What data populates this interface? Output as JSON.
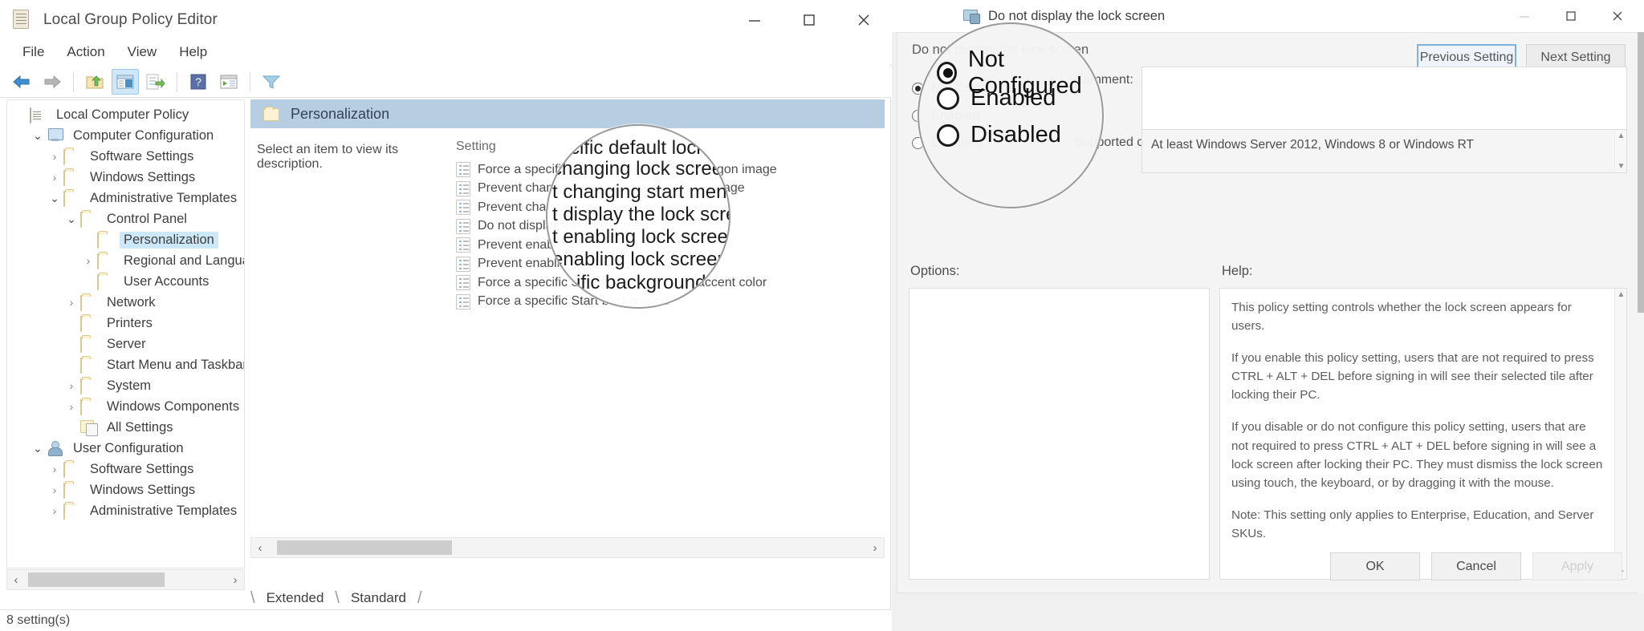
{
  "gpedit": {
    "title": "Local Group Policy Editor",
    "title_icon": "policy-document-icon",
    "window_controls": {
      "minimize": "minimize-icon",
      "maximize": "maximize-icon",
      "close": "close-icon"
    },
    "menu": [
      "File",
      "Action",
      "View",
      "Help"
    ],
    "toolbar_icons": [
      "back-arrow-icon",
      "forward-arrow-icon",
      "up-folder-icon",
      "show-hide-console-tree-icon",
      "export-list-icon",
      "help-icon",
      "show-hide-action-pane-icon",
      "filter-icon"
    ],
    "tree": [
      {
        "label": "Local Computer Policy",
        "indent": 0,
        "chevron": "",
        "icon": "policy-document-icon",
        "selected": false
      },
      {
        "label": "Computer Configuration",
        "indent": 1,
        "chevron": "open",
        "icon": "computer-icon",
        "selected": false
      },
      {
        "label": "Software Settings",
        "indent": 2,
        "chevron": "closed",
        "icon": "folder-icon",
        "selected": false
      },
      {
        "label": "Windows Settings",
        "indent": 2,
        "chevron": "closed",
        "icon": "folder-icon",
        "selected": false
      },
      {
        "label": "Administrative Templates",
        "indent": 2,
        "chevron": "open",
        "icon": "folder-icon",
        "selected": false
      },
      {
        "label": "Control Panel",
        "indent": 3,
        "chevron": "open",
        "icon": "folder-icon",
        "selected": false
      },
      {
        "label": "Personalization",
        "indent": 4,
        "chevron": "",
        "icon": "folder-icon",
        "selected": true
      },
      {
        "label": "Regional and Language Options",
        "indent": 4,
        "chevron": "closed",
        "icon": "folder-icon",
        "selected": false
      },
      {
        "label": "User Accounts",
        "indent": 4,
        "chevron": "",
        "icon": "folder-icon",
        "selected": false
      },
      {
        "label": "Network",
        "indent": 3,
        "chevron": "closed",
        "icon": "folder-icon",
        "selected": false
      },
      {
        "label": "Printers",
        "indent": 3,
        "chevron": "",
        "icon": "folder-icon",
        "selected": false
      },
      {
        "label": "Server",
        "indent": 3,
        "chevron": "",
        "icon": "folder-icon",
        "selected": false
      },
      {
        "label": "Start Menu and Taskbar",
        "indent": 3,
        "chevron": "",
        "icon": "folder-icon",
        "selected": false
      },
      {
        "label": "System",
        "indent": 3,
        "chevron": "closed",
        "icon": "folder-icon",
        "selected": false
      },
      {
        "label": "Windows Components",
        "indent": 3,
        "chevron": "closed",
        "icon": "folder-icon",
        "selected": false
      },
      {
        "label": "All Settings",
        "indent": 3,
        "chevron": "",
        "icon": "all-settings-icon",
        "selected": false
      },
      {
        "label": "User Configuration",
        "indent": 1,
        "chevron": "open",
        "icon": "user-icon",
        "selected": false
      },
      {
        "label": "Software Settings",
        "indent": 2,
        "chevron": "closed",
        "icon": "folder-icon",
        "selected": false
      },
      {
        "label": "Windows Settings",
        "indent": 2,
        "chevron": "closed",
        "icon": "folder-icon",
        "selected": false
      },
      {
        "label": "Administrative Templates",
        "indent": 2,
        "chevron": "closed",
        "icon": "folder-icon",
        "selected": false
      }
    ],
    "pane": {
      "header_title": "Personalization",
      "description_hint": "Select an item to view its description.",
      "column_header": "Setting",
      "settings": [
        "Force a specific default lock screen and logon image",
        "Prevent changing lock screen and logon image",
        "Prevent changing start menu background",
        "Do not display the lock screen",
        "Prevent enabling lock screen camera",
        "Prevent enabling lock screen slide show",
        "Force a specific Start background and accent color",
        "Force a specific Start background"
      ]
    },
    "tabs": [
      "Extended",
      "Standard"
    ],
    "active_tab": "Standard",
    "status": "8 setting(s)"
  },
  "dialog": {
    "title": "Do not display the lock screen",
    "title_icon": "policy-setting-icon",
    "window_controls": {
      "minimize": "minimize-icon",
      "maximize": "maximize-icon",
      "close": "close-icon"
    },
    "policy_heading": "Do not display the lock screen",
    "nav": {
      "previous": "Previous Setting",
      "next": "Next Setting"
    },
    "states": [
      {
        "label": "Not Configured",
        "checked": true
      },
      {
        "label": "Enabled",
        "checked": false
      },
      {
        "label": "Disabled",
        "checked": false
      }
    ],
    "comment_label": "Comment:",
    "comment_value": "",
    "supported_label": "Supported on:",
    "supported_value": "At least Windows Server 2012, Windows 8 or Windows RT",
    "options_label": "Options:",
    "help_label": "Help:",
    "help_paragraphs": [
      "This policy setting controls whether the lock screen appears for users.",
      "If you enable this policy setting, users that are not required to press CTRL + ALT + DEL before signing in will see their selected tile after locking their PC.",
      "If you disable or do not configure this policy setting, users that are not required to press CTRL + ALT + DEL before signing in will see a lock screen after locking their PC. They must dismiss the lock screen using touch, the keyboard, or by dragging it with the mouse.",
      "Note: This setting only applies to Enterprise, Education, and Server SKUs."
    ],
    "buttons": {
      "ok": "OK",
      "cancel": "Cancel",
      "apply": "Apply"
    }
  },
  "magnifier_left": {
    "name": "magnifier-lens-settings-list",
    "rows": [
      "cific default lock screen and logon image",
      "changing lock screen and logon image",
      "t changing start menu background",
      "t display the lock screen",
      "t enabling lock screen camera",
      "enabling lock screen slide show",
      "ific background"
    ]
  },
  "magnifier_right": {
    "name": "magnifier-lens-policy-states",
    "rows": [
      {
        "label": "Not Configured",
        "checked": true
      },
      {
        "label": "Enabled",
        "checked": false
      },
      {
        "label": "Disabled",
        "checked": false
      }
    ]
  },
  "colors": {
    "pane_header": "#b7cde1",
    "tree_selection": "#cde8f9",
    "focus_border": "#7fb4dc",
    "toolbar_active": "#cfe8f9"
  }
}
